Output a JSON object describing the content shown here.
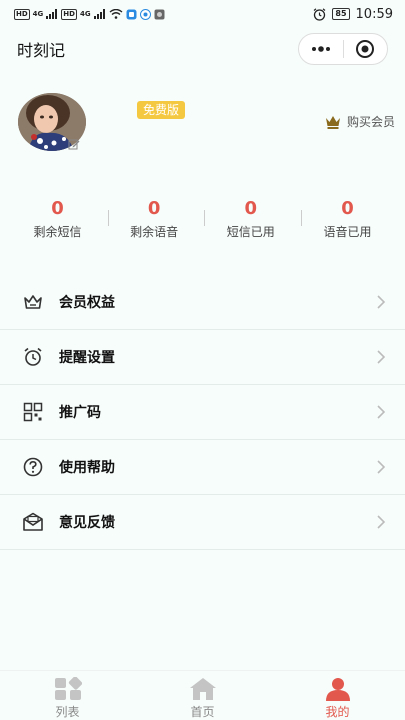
{
  "status_bar": {
    "hd1": "HD",
    "net1": "4G",
    "hd2": "HD",
    "net2": "4G",
    "battery": "85",
    "time": "10:59"
  },
  "header": {
    "title": "时刻记"
  },
  "profile": {
    "badge": "免费版",
    "buy_member": "购买会员"
  },
  "stats": [
    {
      "value": "0",
      "label": "剩余短信"
    },
    {
      "value": "0",
      "label": "剩余语音"
    },
    {
      "value": "0",
      "label": "短信已用"
    },
    {
      "value": "0",
      "label": "语音已用"
    }
  ],
  "menu": [
    {
      "label": "会员权益",
      "icon": "crown-outline-icon"
    },
    {
      "label": "提醒设置",
      "icon": "alarm-clock-icon"
    },
    {
      "label": "推广码",
      "icon": "qr-code-icon"
    },
    {
      "label": "使用帮助",
      "icon": "help-circle-icon"
    },
    {
      "label": "意见反馈",
      "icon": "mail-icon"
    }
  ],
  "tabs": [
    {
      "label": "列表",
      "icon": "grid-icon",
      "active": false
    },
    {
      "label": "首页",
      "icon": "home-icon",
      "active": false
    },
    {
      "label": "我的",
      "icon": "user-icon",
      "active": true
    }
  ],
  "colors": {
    "accent": "#e2584d",
    "badge": "#f5c842",
    "background": "#f7fdfb"
  }
}
